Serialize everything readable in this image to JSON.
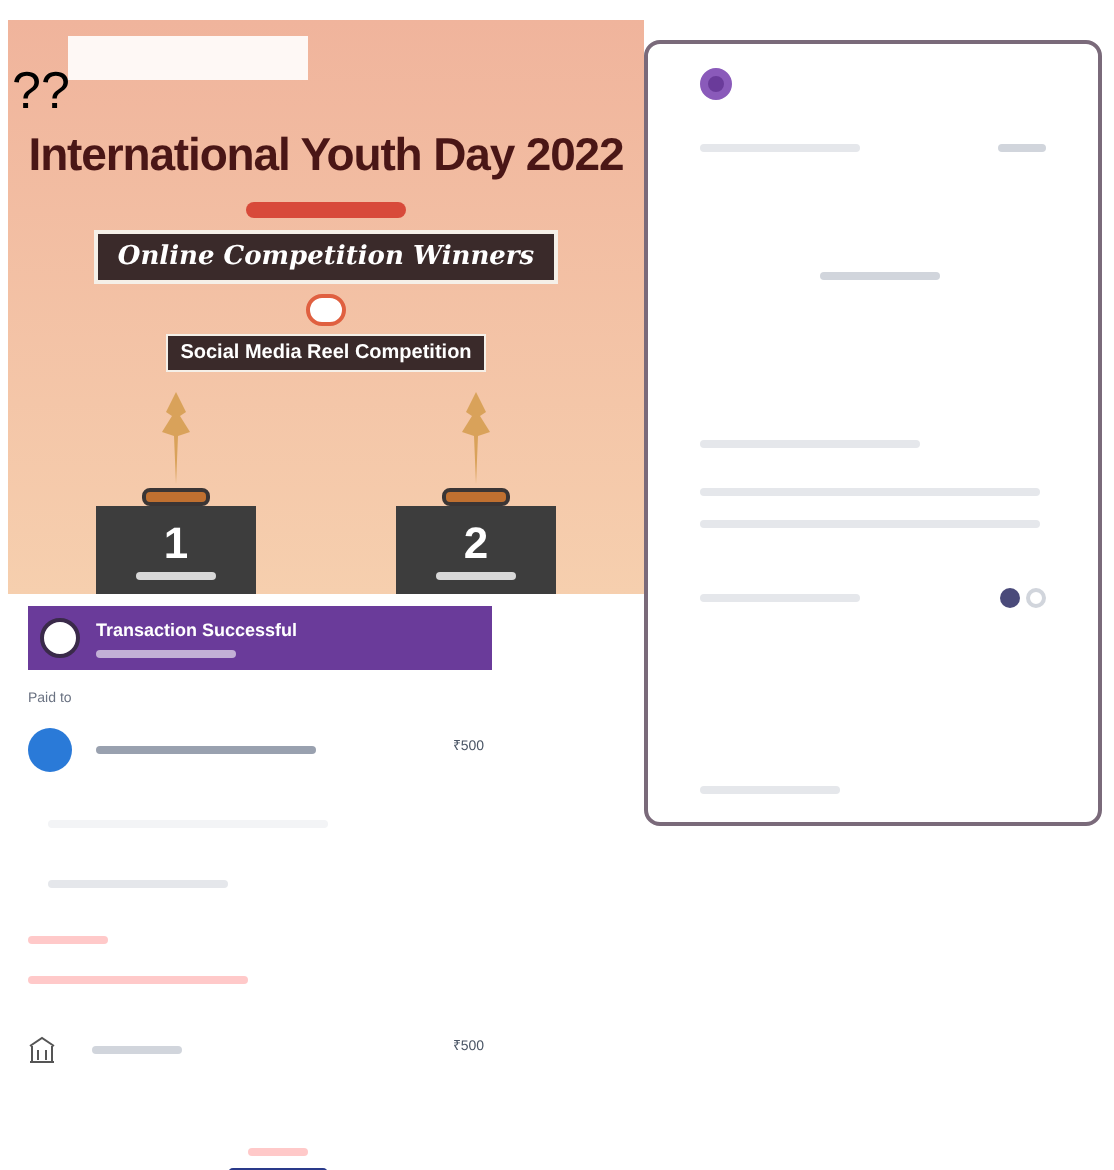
{
  "poster": {
    "overlay_mark": "??",
    "title": "International Youth Day 2022",
    "banner": "Online Competition Winners",
    "category": "Social Media Reel Competition",
    "places": [
      {
        "rank": "1"
      },
      {
        "rank": "2"
      }
    ]
  },
  "receipt": {
    "title": "Transaction Successful",
    "paid_to_label": "Paid to",
    "payee_amount": "₹500",
    "bank_amount": "₹500"
  },
  "details_card": {
    "pager": [
      {
        "selected": true
      },
      {
        "selected": false
      }
    ]
  }
}
